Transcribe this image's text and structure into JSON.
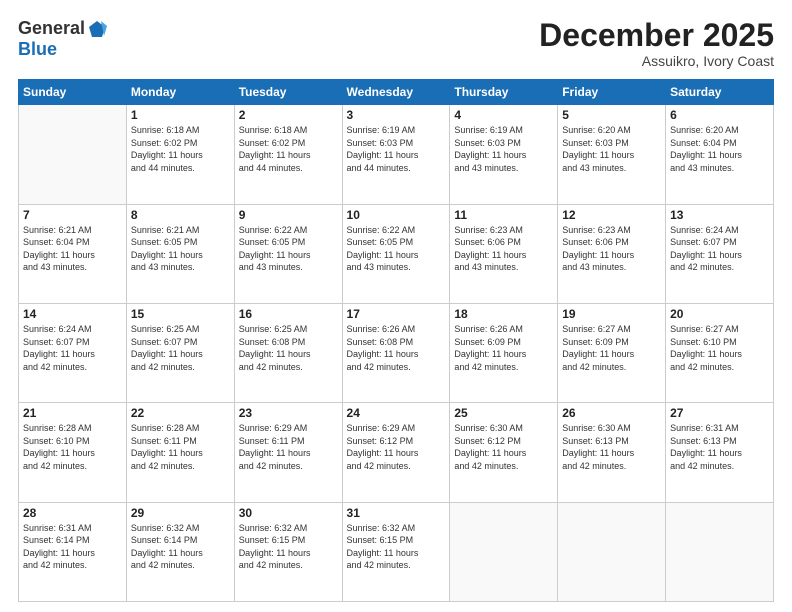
{
  "header": {
    "logo_general": "General",
    "logo_blue": "Blue",
    "month": "December 2025",
    "location": "Assuikro, Ivory Coast"
  },
  "days_of_week": [
    "Sunday",
    "Monday",
    "Tuesday",
    "Wednesday",
    "Thursday",
    "Friday",
    "Saturday"
  ],
  "weeks": [
    [
      {
        "num": "",
        "sunrise": "",
        "sunset": "",
        "daylight": "",
        "empty": true
      },
      {
        "num": "1",
        "sunrise": "Sunrise: 6:18 AM",
        "sunset": "Sunset: 6:02 PM",
        "daylight": "Daylight: 11 hours and 44 minutes."
      },
      {
        "num": "2",
        "sunrise": "Sunrise: 6:18 AM",
        "sunset": "Sunset: 6:02 PM",
        "daylight": "Daylight: 11 hours and 44 minutes."
      },
      {
        "num": "3",
        "sunrise": "Sunrise: 6:19 AM",
        "sunset": "Sunset: 6:03 PM",
        "daylight": "Daylight: 11 hours and 44 minutes."
      },
      {
        "num": "4",
        "sunrise": "Sunrise: 6:19 AM",
        "sunset": "Sunset: 6:03 PM",
        "daylight": "Daylight: 11 hours and 43 minutes."
      },
      {
        "num": "5",
        "sunrise": "Sunrise: 6:20 AM",
        "sunset": "Sunset: 6:03 PM",
        "daylight": "Daylight: 11 hours and 43 minutes."
      },
      {
        "num": "6",
        "sunrise": "Sunrise: 6:20 AM",
        "sunset": "Sunset: 6:04 PM",
        "daylight": "Daylight: 11 hours and 43 minutes."
      }
    ],
    [
      {
        "num": "7",
        "sunrise": "Sunrise: 6:21 AM",
        "sunset": "Sunset: 6:04 PM",
        "daylight": "Daylight: 11 hours and 43 minutes."
      },
      {
        "num": "8",
        "sunrise": "Sunrise: 6:21 AM",
        "sunset": "Sunset: 6:05 PM",
        "daylight": "Daylight: 11 hours and 43 minutes."
      },
      {
        "num": "9",
        "sunrise": "Sunrise: 6:22 AM",
        "sunset": "Sunset: 6:05 PM",
        "daylight": "Daylight: 11 hours and 43 minutes."
      },
      {
        "num": "10",
        "sunrise": "Sunrise: 6:22 AM",
        "sunset": "Sunset: 6:05 PM",
        "daylight": "Daylight: 11 hours and 43 minutes."
      },
      {
        "num": "11",
        "sunrise": "Sunrise: 6:23 AM",
        "sunset": "Sunset: 6:06 PM",
        "daylight": "Daylight: 11 hours and 43 minutes."
      },
      {
        "num": "12",
        "sunrise": "Sunrise: 6:23 AM",
        "sunset": "Sunset: 6:06 PM",
        "daylight": "Daylight: 11 hours and 43 minutes."
      },
      {
        "num": "13",
        "sunrise": "Sunrise: 6:24 AM",
        "sunset": "Sunset: 6:07 PM",
        "daylight": "Daylight: 11 hours and 42 minutes."
      }
    ],
    [
      {
        "num": "14",
        "sunrise": "Sunrise: 6:24 AM",
        "sunset": "Sunset: 6:07 PM",
        "daylight": "Daylight: 11 hours and 42 minutes."
      },
      {
        "num": "15",
        "sunrise": "Sunrise: 6:25 AM",
        "sunset": "Sunset: 6:07 PM",
        "daylight": "Daylight: 11 hours and 42 minutes."
      },
      {
        "num": "16",
        "sunrise": "Sunrise: 6:25 AM",
        "sunset": "Sunset: 6:08 PM",
        "daylight": "Daylight: 11 hours and 42 minutes."
      },
      {
        "num": "17",
        "sunrise": "Sunrise: 6:26 AM",
        "sunset": "Sunset: 6:08 PM",
        "daylight": "Daylight: 11 hours and 42 minutes."
      },
      {
        "num": "18",
        "sunrise": "Sunrise: 6:26 AM",
        "sunset": "Sunset: 6:09 PM",
        "daylight": "Daylight: 11 hours and 42 minutes."
      },
      {
        "num": "19",
        "sunrise": "Sunrise: 6:27 AM",
        "sunset": "Sunset: 6:09 PM",
        "daylight": "Daylight: 11 hours and 42 minutes."
      },
      {
        "num": "20",
        "sunrise": "Sunrise: 6:27 AM",
        "sunset": "Sunset: 6:10 PM",
        "daylight": "Daylight: 11 hours and 42 minutes."
      }
    ],
    [
      {
        "num": "21",
        "sunrise": "Sunrise: 6:28 AM",
        "sunset": "Sunset: 6:10 PM",
        "daylight": "Daylight: 11 hours and 42 minutes."
      },
      {
        "num": "22",
        "sunrise": "Sunrise: 6:28 AM",
        "sunset": "Sunset: 6:11 PM",
        "daylight": "Daylight: 11 hours and 42 minutes."
      },
      {
        "num": "23",
        "sunrise": "Sunrise: 6:29 AM",
        "sunset": "Sunset: 6:11 PM",
        "daylight": "Daylight: 11 hours and 42 minutes."
      },
      {
        "num": "24",
        "sunrise": "Sunrise: 6:29 AM",
        "sunset": "Sunset: 6:12 PM",
        "daylight": "Daylight: 11 hours and 42 minutes."
      },
      {
        "num": "25",
        "sunrise": "Sunrise: 6:30 AM",
        "sunset": "Sunset: 6:12 PM",
        "daylight": "Daylight: 11 hours and 42 minutes."
      },
      {
        "num": "26",
        "sunrise": "Sunrise: 6:30 AM",
        "sunset": "Sunset: 6:13 PM",
        "daylight": "Daylight: 11 hours and 42 minutes."
      },
      {
        "num": "27",
        "sunrise": "Sunrise: 6:31 AM",
        "sunset": "Sunset: 6:13 PM",
        "daylight": "Daylight: 11 hours and 42 minutes."
      }
    ],
    [
      {
        "num": "28",
        "sunrise": "Sunrise: 6:31 AM",
        "sunset": "Sunset: 6:14 PM",
        "daylight": "Daylight: 11 hours and 42 minutes."
      },
      {
        "num": "29",
        "sunrise": "Sunrise: 6:32 AM",
        "sunset": "Sunset: 6:14 PM",
        "daylight": "Daylight: 11 hours and 42 minutes."
      },
      {
        "num": "30",
        "sunrise": "Sunrise: 6:32 AM",
        "sunset": "Sunset: 6:15 PM",
        "daylight": "Daylight: 11 hours and 42 minutes."
      },
      {
        "num": "31",
        "sunrise": "Sunrise: 6:32 AM",
        "sunset": "Sunset: 6:15 PM",
        "daylight": "Daylight: 11 hours and 42 minutes."
      },
      {
        "num": "",
        "sunrise": "",
        "sunset": "",
        "daylight": "",
        "empty": true
      },
      {
        "num": "",
        "sunrise": "",
        "sunset": "",
        "daylight": "",
        "empty": true
      },
      {
        "num": "",
        "sunrise": "",
        "sunset": "",
        "daylight": "",
        "empty": true
      }
    ]
  ]
}
